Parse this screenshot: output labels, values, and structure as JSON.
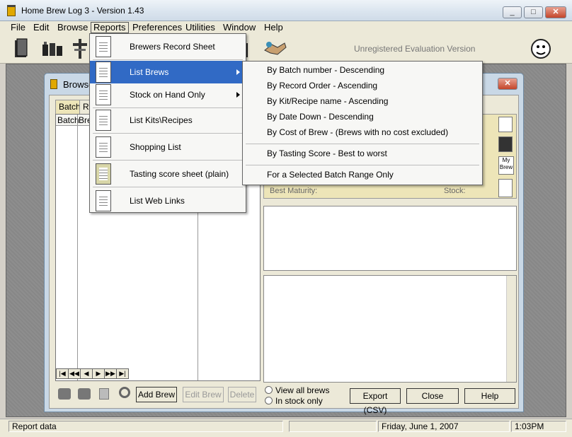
{
  "window": {
    "title": "Home Brew Log 3 - Version 1.43",
    "min": "_",
    "max": "□",
    "close": "✕"
  },
  "menubar": [
    "File",
    "Edit",
    "Browse",
    "Reports",
    "Preferences",
    "Utilities",
    "Window",
    "Help"
  ],
  "toolbar": {
    "notice": "Unregistered Evaluation Version"
  },
  "browse_window": {
    "title": "Browse",
    "tabs": [
      "Batch",
      "Re"
    ],
    "list_columns": [
      "Batch",
      "Bre"
    ],
    "nav_buttons": [
      "|◀",
      "◀◀",
      "◀",
      "▶",
      "▶▶",
      "▶|"
    ],
    "buttons": {
      "add": "Add Brew",
      "edit": "Edit Brew",
      "delete": "Delete",
      "export": "Export (CSV)",
      "close": "Close",
      "help": "Help"
    },
    "fields": {
      "best_maturity": "Best Maturity:",
      "stock": "Stock:"
    },
    "radios": [
      "View all brews",
      "In stock only"
    ],
    "side_icon_label": "My Brew"
  },
  "reports_menu": {
    "items": [
      "Brewers Record Sheet",
      "List Brews",
      "Stock on Hand Only",
      "List Kits\\Recipes",
      "Shopping List",
      "Tasting score sheet (plain)",
      "List Web Links"
    ]
  },
  "list_brews_submenu": {
    "items": [
      "By Batch number - Descending",
      "By Record Order - Ascending",
      "By Kit/Recipe name - Ascending",
      "By Date Down - Descending",
      "By Cost of Brew - (Brews with no cost excluded)",
      "By Tasting Score - Best to worst",
      "For a Selected Batch Range Only"
    ]
  },
  "statusbar": {
    "message": "Report data",
    "date": "Friday, June  1, 2007",
    "time": "1:03PM"
  },
  "colors": {
    "highlight": "#316ac5",
    "tab_yellow": "#ede5b8"
  }
}
